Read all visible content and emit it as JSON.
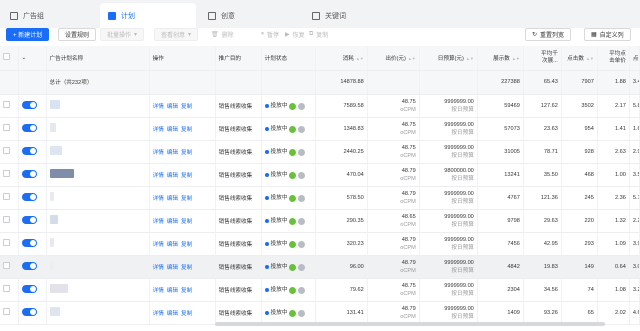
{
  "tabs": [
    {
      "label": "广告组",
      "icon": "folder-icon"
    },
    {
      "label": "计划",
      "icon": "plan-icon"
    },
    {
      "label": "创意",
      "icon": "creative-icon"
    },
    {
      "label": "关键词",
      "icon": "keyword-icon"
    }
  ],
  "toolbar": {
    "new_plan": "+ 新建计划",
    "set_rules": "设置规则",
    "bulk_ops": "批量操作",
    "view_creative": "查看创意",
    "delete": "删除",
    "pause": "暂停",
    "resume": "恢复",
    "copy": "复制",
    "reset_columns": "重置列宽",
    "custom_columns": "自定义列"
  },
  "columns": {
    "name": "广告计划名称",
    "ops": "操作",
    "goal": "推广目的",
    "status": "计划状态",
    "spend": "消耗",
    "bid": "出价(元)",
    "budget": "日预算(元)",
    "impressions": "展示数",
    "cpm_line1": "平均千",
    "cpm_line2": "次展...",
    "clicks": "点击数",
    "cpc_line1": "平均点",
    "cpc_line2": "击单价",
    "ctr": "点击率"
  },
  "total": {
    "label": "总计（共232项）",
    "spend": "14878.88",
    "impressions": "227388",
    "cpm": "65.43",
    "clicks": "7907",
    "cpc": "1.88",
    "ctr": "3.4"
  },
  "row_ops": {
    "detail": "详情",
    "edit": "编辑",
    "copy": "复制"
  },
  "status_label": "投放中",
  "status_tags": [
    "全",
    "受"
  ],
  "rows": [
    {
      "goal": "销售线索收集",
      "spend": "7589.58",
      "bid": "48.75",
      "bid_unit": "oCPM",
      "budget": "9999999.00",
      "budget_sub": "按日预算",
      "impressions": "59469",
      "cpm": "127.62",
      "clicks": "3502",
      "cpc": "2.17",
      "ctr": "5.8"
    },
    {
      "goal": "销售线索收集",
      "spend": "1348.83",
      "bid": "48.75",
      "bid_unit": "oCPM",
      "budget": "9999999.00",
      "budget_sub": "按日预算",
      "impressions": "57073",
      "cpm": "23.63",
      "clicks": "954",
      "cpc": "1.41",
      "ctr": "1.6"
    },
    {
      "goal": "销售线索收集",
      "spend": "2440.25",
      "bid": "48.75",
      "bid_unit": "oCPM",
      "budget": "9999999.00",
      "budget_sub": "按日预算",
      "impressions": "31005",
      "cpm": "78.71",
      "clicks": "928",
      "cpc": "2.63",
      "ctr": "2.9"
    },
    {
      "goal": "销售线索收集",
      "spend": "470.04",
      "bid": "48.79",
      "bid_unit": "oCPM",
      "budget": "9800000.00",
      "budget_sub": "按日预算",
      "impressions": "13241",
      "cpm": "35.50",
      "clicks": "468",
      "cpc": "1.00",
      "ctr": "3.5"
    },
    {
      "goal": "销售线索收集",
      "spend": "578.50",
      "bid": "48.79",
      "bid_unit": "oCPM",
      "budget": "9999999.00",
      "budget_sub": "按日预算",
      "impressions": "4767",
      "cpm": "121.36",
      "clicks": "245",
      "cpc": "2.36",
      "ctr": "5.1"
    },
    {
      "goal": "销售线索收集",
      "spend": "290.35",
      "bid": "48.65",
      "bid_unit": "oCPM",
      "budget": "9999999.00",
      "budget_sub": "按日预算",
      "impressions": "9798",
      "cpm": "29.63",
      "clicks": "220",
      "cpc": "1.32",
      "ctr": "2.2"
    },
    {
      "goal": "销售线索收集",
      "spend": "320.23",
      "bid": "48.79",
      "bid_unit": "oCPM",
      "budget": "9999999.00",
      "budget_sub": "按日预算",
      "impressions": "7456",
      "cpm": "42.95",
      "clicks": "293",
      "cpc": "1.09",
      "ctr": "3.9"
    },
    {
      "goal": "销售线索收集",
      "spend": "96.00",
      "bid": "48.79",
      "bid_unit": "oCPM",
      "budget": "9999999.00",
      "budget_sub": "按日预算",
      "impressions": "4842",
      "cpm": "19.83",
      "clicks": "149",
      "cpc": "0.64",
      "ctr": "3.0"
    },
    {
      "goal": "销售线索收集",
      "spend": "79.62",
      "bid": "48.75",
      "bid_unit": "oCPM",
      "budget": "9999999.00",
      "budget_sub": "按日预算",
      "impressions": "2304",
      "cpm": "34.56",
      "clicks": "74",
      "cpc": "1.08",
      "ctr": "3.2"
    },
    {
      "goal": "销售线索收集",
      "spend": "131.41",
      "bid": "48.79",
      "bid_unit": "oCPM",
      "budget": "9999999.00",
      "budget_sub": "按日预算",
      "impressions": "1409",
      "cpm": "93.26",
      "clicks": "65",
      "cpc": "2.02",
      "ctr": "4.6"
    }
  ],
  "colors": {
    "accent": "#1a6ef5",
    "tag_green": "#67c23a",
    "tag_grey": "#b8bcc4"
  }
}
